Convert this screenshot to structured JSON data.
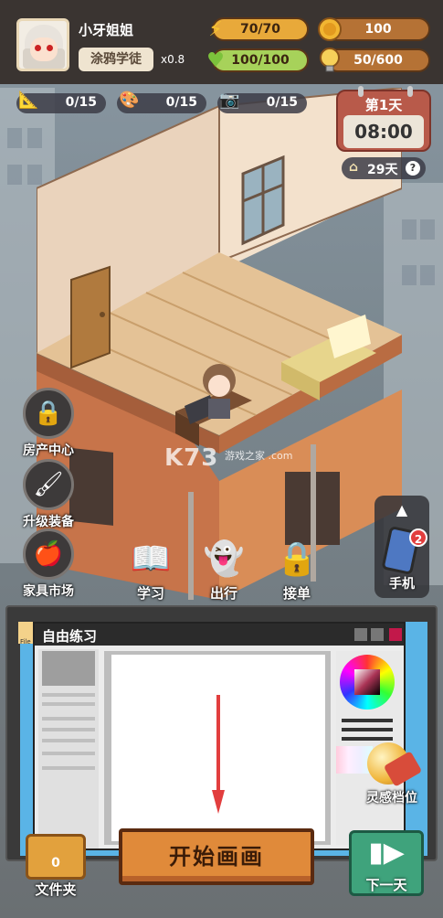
{
  "player": {
    "name": "小牙姐姐",
    "title": "涂鸦学徒",
    "multiplier": "x0.8"
  },
  "stats": {
    "energy": "70/70",
    "coins": "100",
    "health": "100/100",
    "inspiration": "50/600",
    "energy_fill": 1.0,
    "health_fill": 1.0
  },
  "skills": [
    {
      "icon": "ruler-icon",
      "value": "0/15"
    },
    {
      "icon": "palette-icon",
      "value": "0/15"
    },
    {
      "icon": "camera-icon",
      "value": "0/15"
    }
  ],
  "calendar": {
    "day": "第1天",
    "time": "08:00",
    "days_left": "29天",
    "help": "?"
  },
  "side_menu": [
    {
      "label": "房产中心",
      "icon": "lock-icon"
    },
    {
      "label": "升级装备",
      "icon": "brushes-icon"
    },
    {
      "label": "家具市场",
      "icon": "furniture-icon"
    }
  ],
  "actions": [
    {
      "label": "学习",
      "icon": "book-icon"
    },
    {
      "label": "出行",
      "icon": "ghost-icon"
    },
    {
      "label": "接单",
      "icon": "lock-icon"
    }
  ],
  "phone": {
    "label": "手机",
    "badge": "2"
  },
  "watermark": {
    "main": "K73",
    "sub": "游戏之家 .com"
  },
  "paint_window": {
    "title": "自由练习",
    "side_label": "File"
  },
  "inspiration_button": {
    "label": "灵感档位"
  },
  "bottom": {
    "folder_count": "0",
    "folder_label": "文件夹",
    "start_label": "开始画画",
    "next_label": "下一天"
  },
  "colors": {
    "energy": "#e8a93a",
    "health": "#a7d25a",
    "start_button": "#e08a3a",
    "next_button": "#3fa37c"
  }
}
